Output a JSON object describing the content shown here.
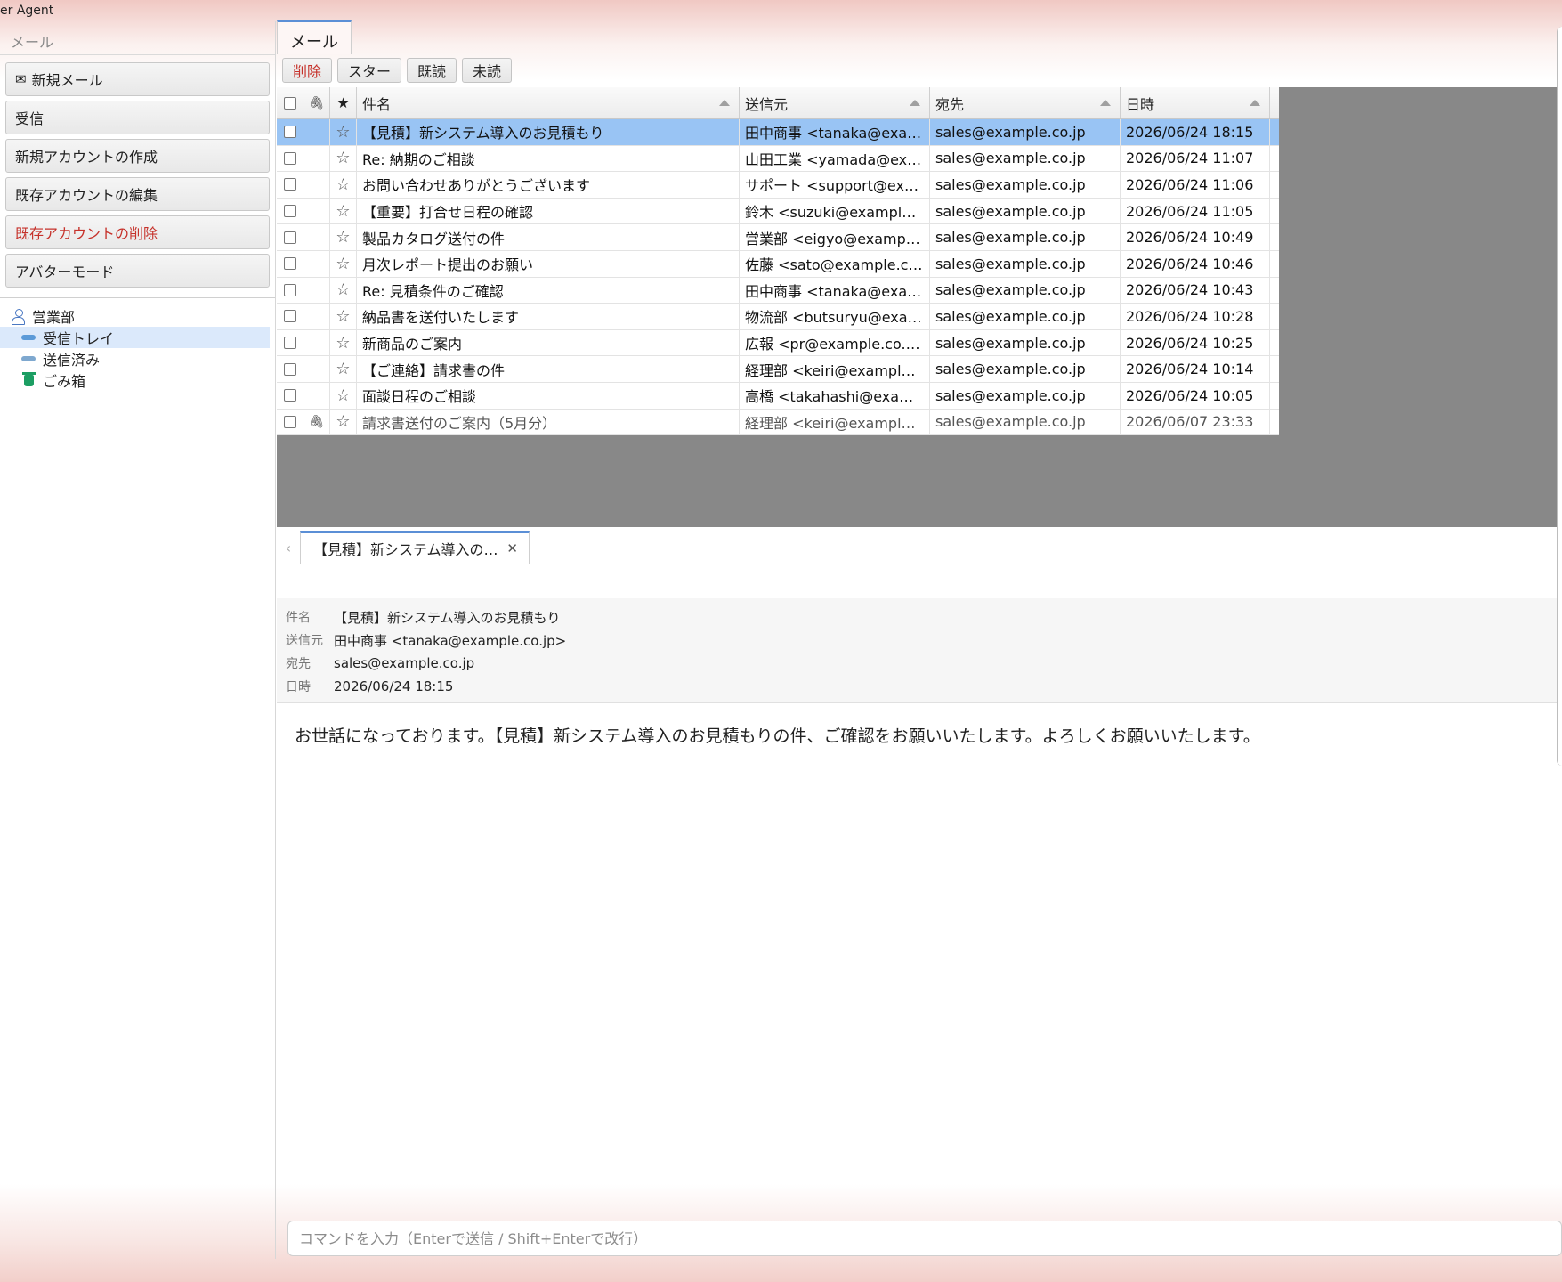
{
  "window": {
    "title": "er Agent"
  },
  "sidebar": {
    "tab_label": "メール",
    "buttons": [
      {
        "label": "新規メール",
        "icon": "envelope-icon",
        "danger": false
      },
      {
        "label": "受信",
        "danger": false
      },
      {
        "label": "新規アカウントの作成",
        "danger": false
      },
      {
        "label": "既存アカウントの編集",
        "danger": false
      },
      {
        "label": "既存アカウントの削除",
        "danger": true
      },
      {
        "label": "アバターモード",
        "danger": false
      }
    ],
    "tree": {
      "account": "営業部",
      "folders": [
        "受信トレイ",
        "送信済み",
        "ごみ箱"
      ]
    }
  },
  "main": {
    "tab_label": "メール",
    "toolbar": {
      "delete": "削除",
      "star": "スター",
      "mark_read": "既読",
      "mark_unread": "未読"
    },
    "columns": {
      "star": "★",
      "subject": "件名",
      "from": "送信元",
      "to": "宛先",
      "date": "日時"
    },
    "messages": [
      {
        "subject": "【見積】新システム導入のお見積もり",
        "from": "田中商事 <tanaka@exam...",
        "to": "sales@example.co.jp",
        "date": "2026/06/24 18:15",
        "attachment": false,
        "read": false,
        "selected": true
      },
      {
        "subject": "Re: 納期のご相談",
        "from": "山田工業 <yamada@exa...",
        "to": "sales@example.co.jp",
        "date": "2026/06/24 11:07",
        "attachment": false,
        "read": false
      },
      {
        "subject": "お問い合わせありがとうございます",
        "from": "サポート <support@exam...",
        "to": "sales@example.co.jp",
        "date": "2026/06/24 11:06",
        "attachment": false,
        "read": false
      },
      {
        "subject": "【重要】打合せ日程の確認",
        "from": "鈴木 <suzuki@example.c...",
        "to": "sales@example.co.jp",
        "date": "2026/06/24 11:05",
        "attachment": false,
        "read": false
      },
      {
        "subject": "製品カタログ送付の件",
        "from": "営業部 <eigyo@example...",
        "to": "sales@example.co.jp",
        "date": "2026/06/24 10:49",
        "attachment": false,
        "read": false
      },
      {
        "subject": "月次レポート提出のお願い",
        "from": "佐藤 <sato@example.co....",
        "to": "sales@example.co.jp",
        "date": "2026/06/24 10:46",
        "attachment": false,
        "read": false
      },
      {
        "subject": "Re: 見積条件のご確認",
        "from": "田中商事 <tanaka@exam...",
        "to": "sales@example.co.jp",
        "date": "2026/06/24 10:43",
        "attachment": false,
        "read": false
      },
      {
        "subject": "納品書を送付いたします",
        "from": "物流部 <butsuryu@exam...",
        "to": "sales@example.co.jp",
        "date": "2026/06/24 10:28",
        "attachment": false,
        "read": false
      },
      {
        "subject": "新商品のご案内",
        "from": "広報 <pr@example.co.jp>",
        "to": "sales@example.co.jp",
        "date": "2026/06/24 10:25",
        "attachment": false,
        "read": false
      },
      {
        "subject": "【ご連絡】請求書の件",
        "from": "経理部 <keiri@example....",
        "to": "sales@example.co.jp",
        "date": "2026/06/24 10:14",
        "attachment": false,
        "read": false
      },
      {
        "subject": "面談日程のご相談",
        "from": "高橋 <takahashi@examp...",
        "to": "sales@example.co.jp",
        "date": "2026/06/24 10:05",
        "attachment": false,
        "read": false
      },
      {
        "subject": "請求書送付のご案内（5月分）",
        "from": "経理部 <keiri@example.c...",
        "to": "sales@example.co.jp",
        "date": "2026/06/07 23:33",
        "attachment": true,
        "read": true
      }
    ]
  },
  "preview": {
    "tab_title": "【見積】新システム導入の…",
    "labels": {
      "subject": "件名",
      "from": "送信元",
      "to": "宛先",
      "date": "日時"
    },
    "subject": "【見積】新システム導入のお見積もり",
    "from": "田中商事 <tanaka@example.co.jp>",
    "to": "sales@example.co.jp",
    "date": "2026/06/24 18:15",
    "body": "お世話になっております。【見積】新システム導入のお見積もりの件、ご確認をお願いいたします。よろしくお願いいたします。"
  },
  "command": {
    "placeholder": "コマンドを入力（Enterで送信 / Shift+Enterで改行）",
    "value": ""
  },
  "colors": {
    "selection": "#99c4f4",
    "accent": "#5b8fd6",
    "danger": "#c6322b",
    "list_background": "#888888"
  }
}
